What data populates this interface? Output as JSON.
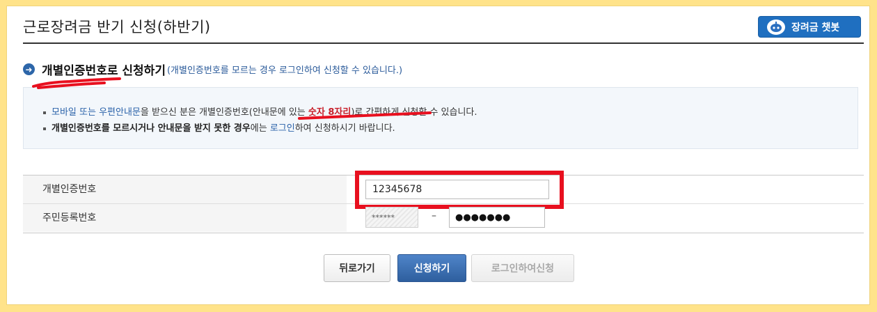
{
  "page": {
    "title": "근로장려금 반기 신청(하반기)",
    "chatbot_label": "장려금 챗봇"
  },
  "section": {
    "title": "개별인증번호로 신청하기",
    "note": "(개별인증번호를 모르는 경우 로그인하여 신청할 수 있습니다.)"
  },
  "info": {
    "line1": {
      "link": "모바일 또는 우편안내문",
      "text1": "을 받으신 분은 개별인증번호(안내문에 있는 ",
      "red": "숫자 8자리",
      "text2": ")로 간편하게 신청할 수 있습니다."
    },
    "line2": {
      "bold": "개별인증번호를 모르시거나 안내문을 받지 못한 경우",
      "text1": "에는 ",
      "link": "로그인",
      "text2": "하여 신청하시기 바랍니다."
    }
  },
  "form": {
    "cert_label": "개별인증번호",
    "cert_value": "12345678",
    "rrn_label": "주민등록번호",
    "rrn_front": "******",
    "rrn_dash": "–",
    "rrn_back": "●●●●●●●"
  },
  "buttons": {
    "back": "뒤로가기",
    "apply": "신청하기",
    "login_apply": "로그인하여신청"
  },
  "colors": {
    "background": "#ffe38a",
    "accent": "#1f6fc0",
    "annotation": "#e8101f"
  }
}
